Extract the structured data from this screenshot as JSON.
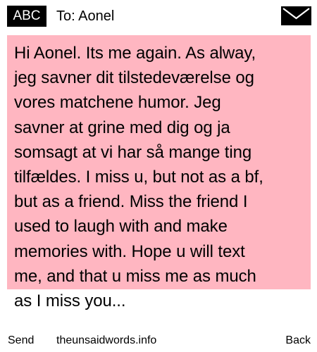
{
  "header": {
    "badge": "ABC",
    "to_label": "To: Aonel",
    "icon": "envelope-icon"
  },
  "message": {
    "lines": [
      "Hi Aonel. Its me again. As alway,",
      "jeg savner dit tilstedeværelse og",
      "vores matchene humor. Jeg",
      "savner at grine med dig og ja",
      "somsagt at vi har så mange ting",
      "tilfældes. I miss u, but not as a bf,",
      "but as a friend. Miss the friend I",
      "used to laugh with and make",
      "memories with. Hope u will text",
      "me, and that u miss me as much",
      "as I miss you..."
    ],
    "background_color": "#ffb6c1"
  },
  "footer": {
    "send_label": "Send",
    "site_label": "theunsaidwords.info",
    "back_label": "Back"
  }
}
